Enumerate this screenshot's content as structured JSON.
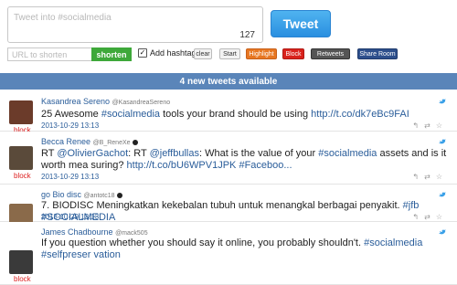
{
  "composer": {
    "placeholder": "Tweet into #socialmedia",
    "char_count": "127",
    "tweet_label": "Tweet"
  },
  "toolbar": {
    "url_placeholder": "URL to shorten",
    "shorten_label": "shorten",
    "add_hashtag_label": "Add hashtag",
    "add_hashtag_checked": true,
    "clear_label": "clear",
    "start_label": "Start",
    "highlight_label": "Highlight",
    "block_label": "Block",
    "retweets_label": "Retweets",
    "share_label": "Share Room"
  },
  "banner": {
    "text": "4 new tweets available"
  },
  "tweets": [
    {
      "name": "Kasandrea Sereno",
      "handle": "@KasandreaSereno",
      "verified": false,
      "block": "block",
      "segments": [
        {
          "t": "25 Awesome ",
          "k": "plain"
        },
        {
          "t": "#socialmedia",
          "k": "tag"
        },
        {
          "t": " tools your brand should be using ",
          "k": "plain"
        },
        {
          "t": "http://t.co/dk7eBc9FAI",
          "k": "link"
        }
      ],
      "time": "2013-10-29 13:13",
      "avatar_color": "#6b3b2a"
    },
    {
      "name": "Becca Renee",
      "handle": "@B_ReneXe",
      "verified": true,
      "block": "block",
      "segments": [
        {
          "t": "RT ",
          "k": "plain"
        },
        {
          "t": "@OlivierGachot",
          "k": "tag"
        },
        {
          "t": ": RT ",
          "k": "plain"
        },
        {
          "t": "@jeffbullas",
          "k": "tag"
        },
        {
          "t": ": What is the value of your ",
          "k": "plain"
        },
        {
          "t": "#socialmedia",
          "k": "tag"
        },
        {
          "t": " assets and is it worth mea suring? ",
          "k": "plain"
        },
        {
          "t": "http://t.co/bU6WPV1JPK",
          "k": "link"
        },
        {
          "t": " ",
          "k": "plain"
        },
        {
          "t": "#Faceboo...",
          "k": "tag"
        }
      ],
      "time": "2013-10-29 13:13",
      "avatar_color": "#5a4a3a"
    },
    {
      "name": "go Bio disc",
      "handle": "@antotc18",
      "verified": true,
      "block": "block",
      "segments": [
        {
          "t": "7. BIODISC Meningkatkan kekebalan tubuh untuk menangkal berbagai penyakit. ",
          "k": "plain"
        },
        {
          "t": "#jfb",
          "k": "tag"
        },
        {
          "t": " ",
          "k": "plain"
        },
        {
          "t": "#SOCIALMEDIA",
          "k": "tag"
        }
      ],
      "time": "2013-10-29 13:13",
      "avatar_color": "#8a6a4a"
    },
    {
      "name": "James Chadbourne",
      "handle": "@mack505",
      "verified": false,
      "block": "block",
      "segments": [
        {
          "t": "If you question whether you should say it online, you probably shouldn't. ",
          "k": "plain"
        },
        {
          "t": "#socialmedia",
          "k": "tag"
        },
        {
          "t": " ",
          "k": "plain"
        },
        {
          "t": "#selfpreser vation",
          "k": "tag"
        }
      ],
      "time": "",
      "avatar_color": "#3a3a3a"
    }
  ],
  "icons": {
    "tweet_source": "twitter-bird-icon",
    "reply": "reply-icon",
    "retweet": "retweet-icon",
    "favorite": "star-icon"
  }
}
